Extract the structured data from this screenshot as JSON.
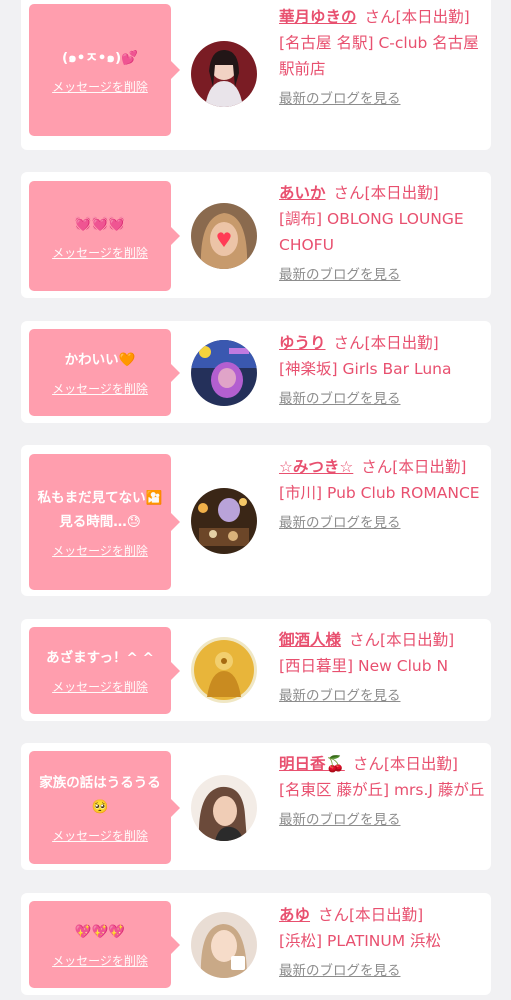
{
  "delete_label": "メッセージを削除",
  "blog_label": "最新のブログを見る",
  "cards": [
    {
      "message": "(๑•ㅈ•๑)💕",
      "name": "華月ゆきの",
      "status": "さん[本日出勤]",
      "shop": "[名古屋 名駅] C-club 名古屋駅前店"
    },
    {
      "message": "💓💓💓",
      "name": "あいか",
      "status": "さん[本日出勤]",
      "shop": "[調布] OBLONG LOUNGE CHOFU"
    },
    {
      "message": "かわいい🧡",
      "name": "ゆうり",
      "status": "さん[本日出勤]",
      "shop": "[神楽坂] Girls Bar Luna"
    },
    {
      "message": "私もまだ見てない🎦見る時間…😓",
      "name": "☆みつき☆",
      "status": "さん[本日出勤]",
      "shop": "[市川] Pub Club ROMANCE"
    },
    {
      "message": "あざますっ！^ ^",
      "name": "御酒人様",
      "status": "さん[本日出勤]",
      "shop": "[西日暮里] New Club N"
    },
    {
      "message": "家族の話はうるうる🥺",
      "name": "明日香🍒",
      "status": "さん[本日出勤]",
      "shop": "[名東区 藤が丘] mrs.J 藤が丘"
    },
    {
      "message": "💖💖💖",
      "name": "あゆ",
      "status": "さん[本日出勤]",
      "shop": "[浜松] PLATINUM 浜松"
    }
  ]
}
